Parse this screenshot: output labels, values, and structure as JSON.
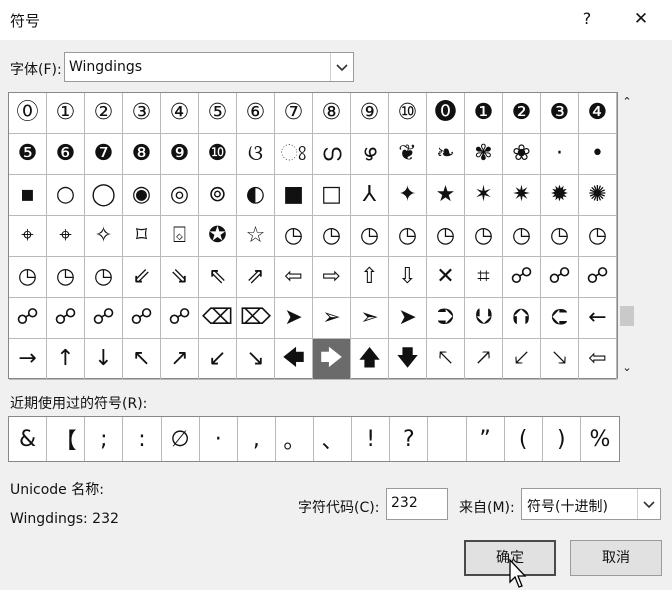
{
  "window": {
    "title": "符号",
    "help_label": "?",
    "close_label": "✕"
  },
  "font": {
    "label": "字体(F):",
    "value": "Wingdings"
  },
  "grid": {
    "rows": [
      [
        "⓪",
        "①",
        "②",
        "③",
        "④",
        "⑤",
        "⑥",
        "⑦",
        "⑧",
        "⑨",
        "⑩",
        "⓿",
        "❶",
        "❷",
        "❸",
        "❹"
      ],
      [
        "❺",
        "❻",
        "❼",
        "❽",
        "❾",
        "❿",
        "ଓ",
        "ଃ",
        "ഗ",
        "ഴ",
        "❦",
        "❧",
        "✾",
        "❀",
        "·",
        "•"
      ],
      [
        "▪",
        "○",
        "◯",
        "◉",
        "◎",
        "⊚",
        "◐",
        "■",
        "□",
        "⅄",
        "✦",
        "★",
        "✶",
        "✷",
        "✹",
        "✺"
      ],
      [
        "⌖",
        "⌖",
        "✧",
        "⌑",
        "⌺",
        "✪",
        "☆",
        "◷",
        "◷",
        "◷",
        "◷",
        "◷",
        "◷",
        "◷",
        "◷",
        "◷"
      ],
      [
        "◷",
        "◷",
        "◷",
        "⇙",
        "⇘",
        "⇖",
        "⇗",
        "⇦",
        "⇨",
        "⇧",
        "⇩",
        "✕",
        "⌗",
        "☍",
        "☍",
        "☍"
      ],
      [
        "☍",
        "☍",
        "☍",
        "☍",
        "☍",
        "⌫",
        "⌦",
        "➤",
        "➢",
        "➣",
        "➤",
        "⮊",
        "⮋",
        "⮉",
        "⮈",
        "←"
      ],
      [
        "→",
        "↑",
        "↓",
        "↖",
        "↗",
        "↙",
        "↘",
        "🡄",
        "🡆",
        "🡅",
        "🡇",
        "🡔",
        "🡕",
        "🡗",
        "🡖",
        "⇦"
      ]
    ],
    "selected_symbol": "🡆"
  },
  "recent": {
    "label": "近期使用过的符号(R):",
    "symbols": [
      "&",
      "【",
      ";",
      ":",
      "∅",
      "·",
      ",",
      "。",
      "、",
      "!",
      "?",
      "",
      "”",
      "(",
      ")",
      "%"
    ]
  },
  "unicode": {
    "label": "Unicode 名称:",
    "name": "Wingdings: 232"
  },
  "char_code": {
    "label": "字符代码(C):",
    "value": "232"
  },
  "from": {
    "label": "来自(M):",
    "value": "符号(十进制)"
  },
  "buttons": {
    "ok": "确定",
    "cancel": "取消"
  },
  "scroll": {
    "up": "⌃",
    "down": "⌄"
  }
}
